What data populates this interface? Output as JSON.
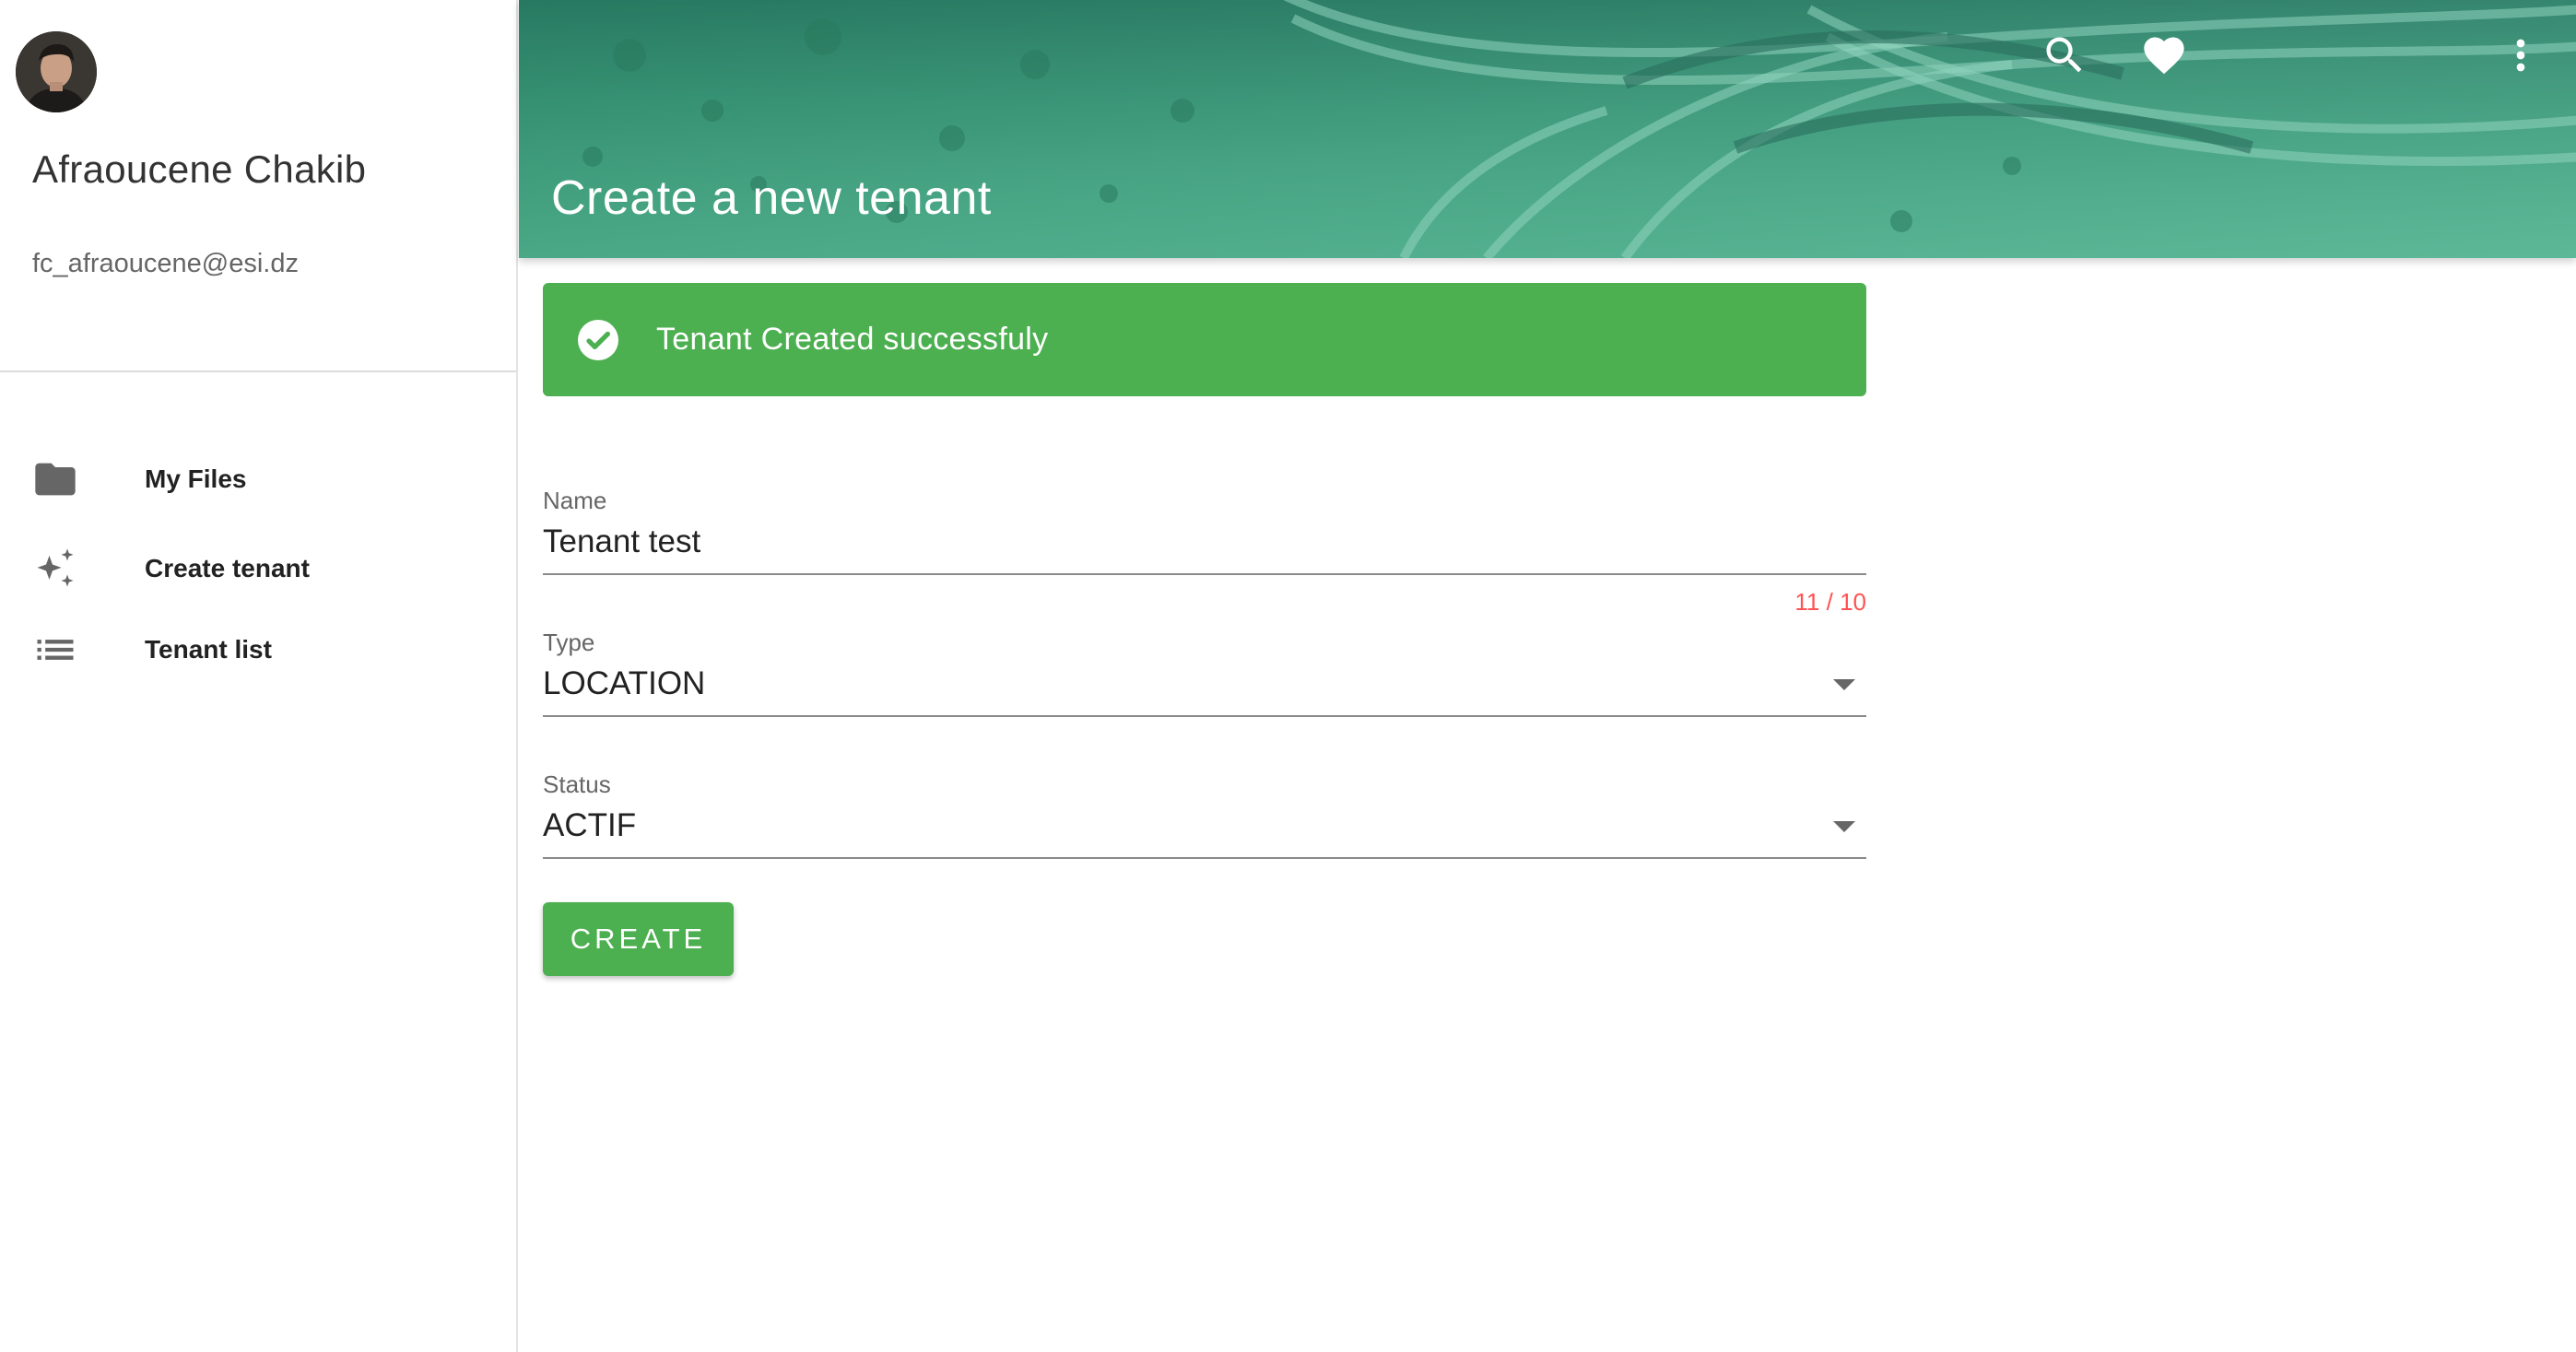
{
  "sidebar": {
    "user": {
      "name": "Afraoucene Chakib",
      "email": "fc_afraoucene@esi.dz"
    },
    "items": [
      {
        "label": "My Files",
        "icon": "folder-icon"
      },
      {
        "label": "Create tenant",
        "icon": "sparkles-icon"
      },
      {
        "label": "Tenant list",
        "icon": "list-icon"
      }
    ]
  },
  "header": {
    "title": "Create a new tenant",
    "actions": [
      "search-icon",
      "heart-icon",
      "more-vert-icon"
    ]
  },
  "alert": {
    "type": "success",
    "icon": "check-circle-icon",
    "message": "Tenant Created successfuly"
  },
  "form": {
    "name": {
      "label": "Name",
      "value": "Tenant test",
      "counter": "11 / 10"
    },
    "type": {
      "label": "Type",
      "value": "LOCATION"
    },
    "status": {
      "label": "Status",
      "value": "ACTIF"
    },
    "submit_label": "CREATE"
  },
  "colors": {
    "accent": "#4caf50",
    "error": "#ff5252",
    "header_tint": "#3f9f7d"
  }
}
